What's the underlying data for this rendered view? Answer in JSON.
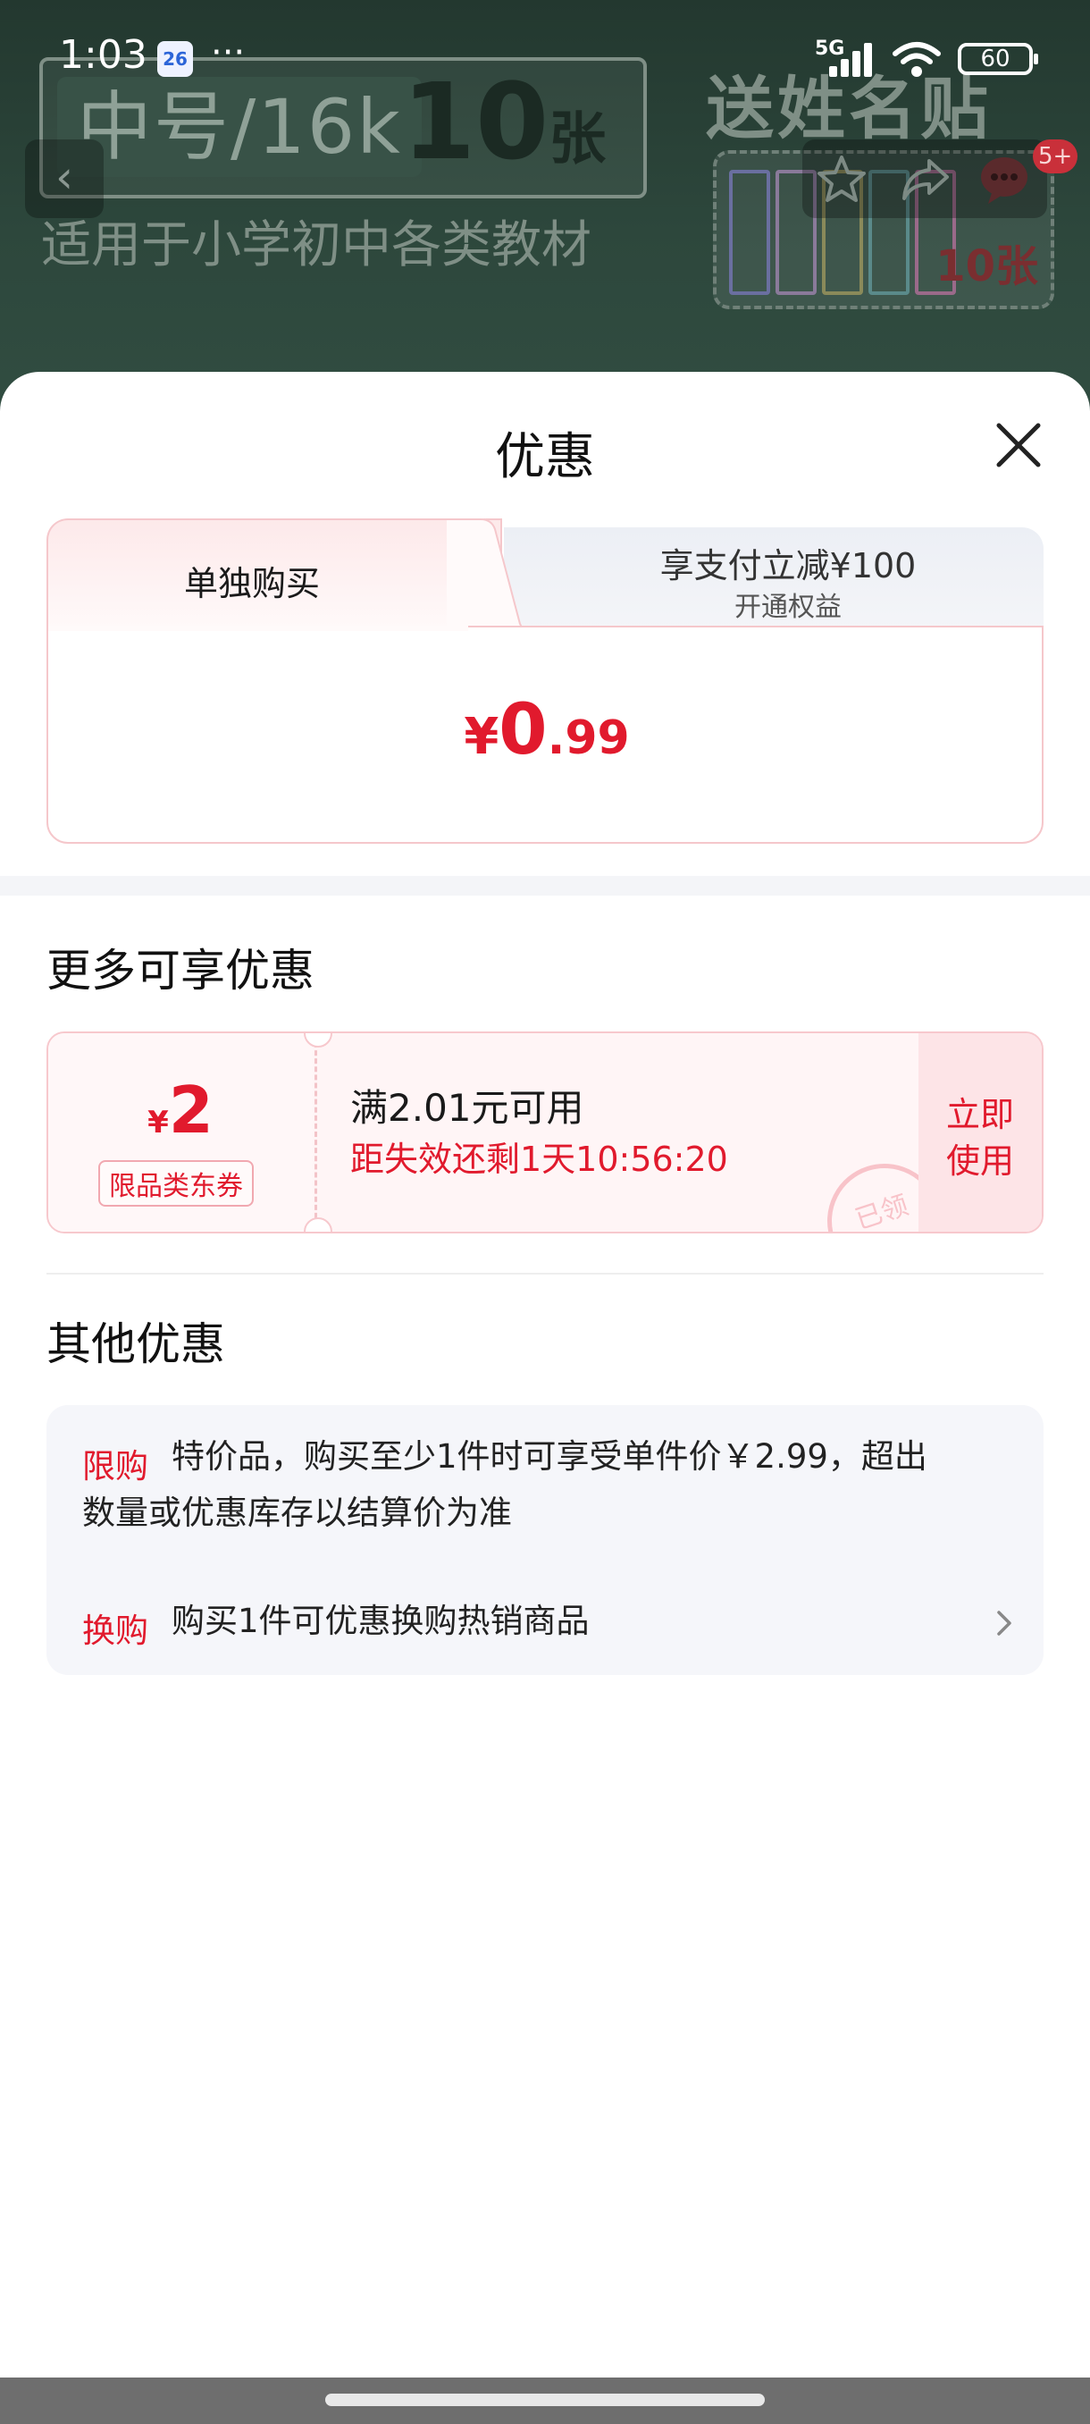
{
  "status_bar": {
    "time": "1:03",
    "calendar_day": "26",
    "more": "···",
    "network": "5G",
    "battery": "60"
  },
  "background_product": {
    "size_label": "中号/16k",
    "count": "10",
    "count_unit": "张",
    "subtitle": "适用于小学初中各类教材",
    "promo_title": "送姓名贴",
    "promo_count": "10张"
  },
  "top_nav": {
    "back_icon": "chevron-left-icon",
    "actions": [
      "star-icon",
      "share-icon",
      "message-icon"
    ],
    "message_badge": "5+"
  },
  "sheet": {
    "title": "优惠",
    "close_icon": "close-icon",
    "tabs": {
      "active": "单独购买",
      "inactive_title": "享支付立减¥100",
      "inactive_sub": "开通权益"
    },
    "price": {
      "currency": "¥",
      "integer": "0",
      "decimal": ".99"
    },
    "more_offers": {
      "title": "更多可享优惠",
      "coupon": {
        "currency": "¥",
        "amount": "2",
        "tag": "限品类东券",
        "condition": "满2.01元可用",
        "expire": "距失效还剩1天10:56:20",
        "stamp": "已领",
        "action_line1": "立即",
        "action_line2": "使用"
      }
    },
    "other_offers": {
      "title": "其他优惠",
      "items": [
        {
          "tag": "限购",
          "text_line1": "特价品，购买至少1件时可享受单件价￥2.99，超出",
          "text_line2": "数量或优惠库存以结算价为准"
        },
        {
          "tag": "换购",
          "text": "购买1件可优惠换购热销商品",
          "icon": "chevron-right-icon"
        }
      ]
    }
  },
  "colors": {
    "accent_red": "#e11a2d",
    "background_green": "#2d473c",
    "panel_gray": "#f5f6fa"
  }
}
